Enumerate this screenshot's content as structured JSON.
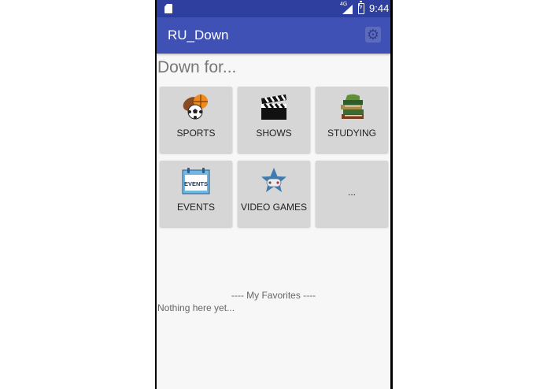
{
  "status_bar": {
    "network": "4G",
    "time": "9:44"
  },
  "app_bar": {
    "title": "RU_Down",
    "settings_icon": "gear-icon"
  },
  "main": {
    "heading": "Down for...",
    "tiles": [
      {
        "label": "SPORTS",
        "icon": "sports-balls-icon"
      },
      {
        "label": "SHOWS",
        "icon": "clapperboard-icon"
      },
      {
        "label": "STUDYING",
        "icon": "books-icon"
      },
      {
        "label": "EVENTS",
        "icon": "calendar-events-icon",
        "icon_text": "EVENTS"
      },
      {
        "label": "VIDEO GAMES",
        "icon": "gamepad-star-icon"
      },
      {
        "label": "...",
        "icon": ""
      }
    ],
    "favorites_header": "---- My Favorites ----",
    "favorites_empty": "Nothing here yet..."
  },
  "colors": {
    "app_bar": "#3f51b5",
    "status_bar": "#2f3fa0",
    "tile_bg": "#d6d6d6"
  }
}
